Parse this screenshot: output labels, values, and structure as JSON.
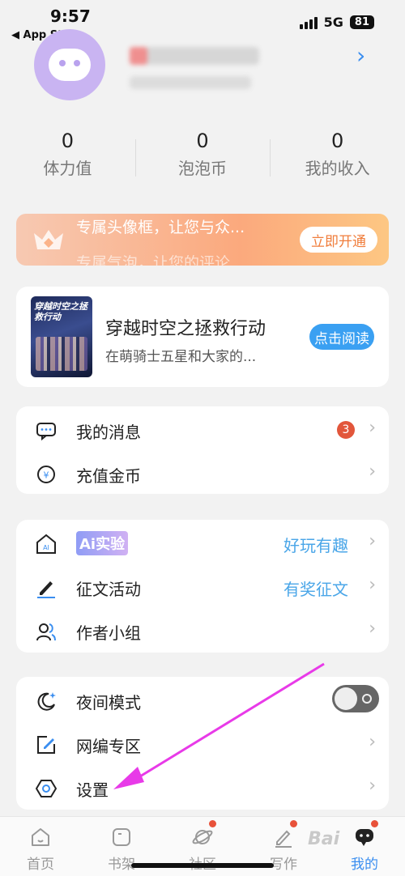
{
  "status_bar": {
    "time": "9:57",
    "back_label": "◀ App Store",
    "network": "5G",
    "battery": "81"
  },
  "stats": [
    {
      "value": "0",
      "label": "体力值"
    },
    {
      "value": "0",
      "label": "泡泡币"
    },
    {
      "value": "0",
      "label": "我的收入"
    }
  ],
  "vip_banner": {
    "text": "专属头像框，让您与众...",
    "text_secondary": "专属气泡，让您的评论...",
    "button": "立即开通"
  },
  "book": {
    "cover_title": "穿越时空之拯救行动",
    "title": "穿越时空之拯救行动",
    "subtitle": "在萌骑士五星和大家的...",
    "button": "点击阅读"
  },
  "menu_group_1": {
    "messages": {
      "label": "我的消息",
      "badge": "3"
    },
    "recharge": {
      "label": "充值金币"
    }
  },
  "menu_group_2": {
    "ai": {
      "label": "Ai实验",
      "extra": "好玩有趣"
    },
    "contest": {
      "label": "征文活动",
      "extra": "有奖征文"
    },
    "author_group": {
      "label": "作者小组"
    }
  },
  "menu_group_3": {
    "night_mode": {
      "label": "夜间模式",
      "enabled": false
    },
    "web_editor": {
      "label": "网编专区"
    },
    "settings": {
      "label": "设置"
    }
  },
  "tabbar": [
    {
      "label": "首页",
      "icon": "home-icon"
    },
    {
      "label": "书架",
      "icon": "bookshelf-icon"
    },
    {
      "label": "社区",
      "icon": "planet-icon"
    },
    {
      "label": "写作",
      "icon": "pen-icon"
    },
    {
      "label": "我的",
      "icon": "chat-face-icon"
    }
  ],
  "watermark": "Bai",
  "colors": {
    "accent": "#3a8ef0",
    "badge": "#e2563b",
    "annotation_arrow": "#e83ae8"
  }
}
